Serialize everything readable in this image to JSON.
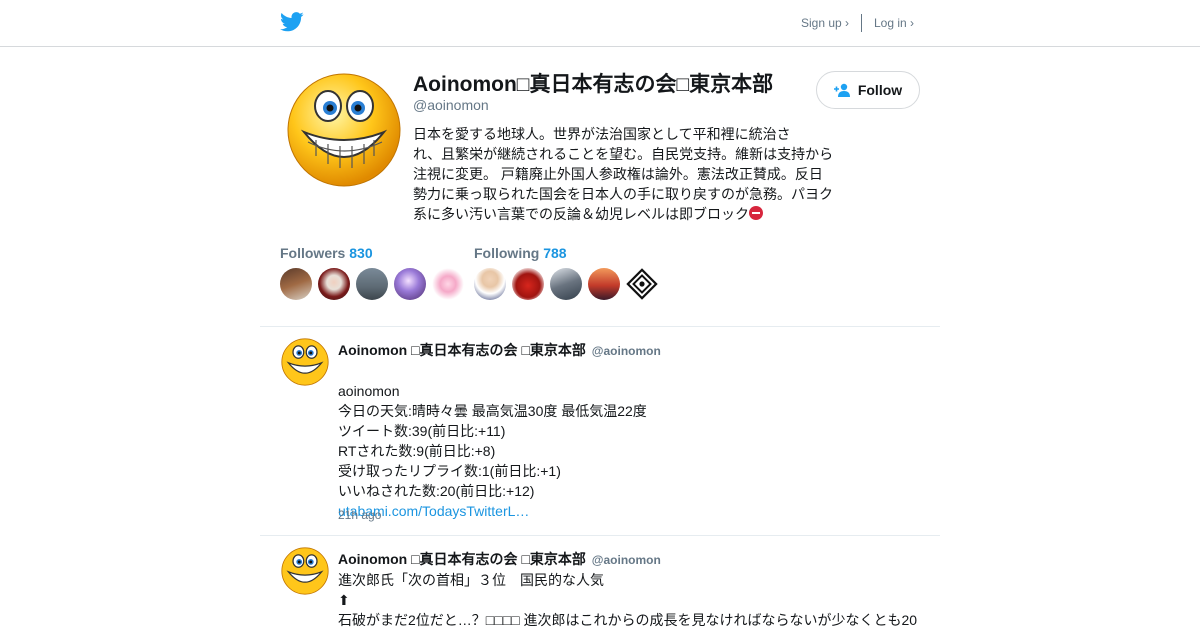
{
  "nav": {
    "signup_label": "Sign up ›",
    "login_label": "Log in ›"
  },
  "profile": {
    "display_name": "Aoinomon□真日本有志の会□東京本部",
    "handle": "@aoinomon",
    "follow_label": "Follow",
    "bio": "日本を愛する地球人。世界が法治国家として平和裡に統治さ\nれ、且繁栄が継続されることを望む。自民党支持。維新は支持から\n注視に変更。 戸籍廃止外国人参政権は論外。憲法改正賛成。反日\n勢力に乗っ取られた国会を日本人の手に取り戻すのが急務。パヨク\n系に多い汚い言葉での反論＆幼児レベルは即ブロック"
  },
  "stats": {
    "followers_label": "Followers",
    "followers_count": "830",
    "following_label": "Following",
    "following_count": "788"
  },
  "tweets": [
    {
      "name": "Aoinomon □真日本有志の会 □東京本部",
      "handle": "@aoinomon",
      "text": "aoinomon\n今日の天気:晴時々曇 最高気温30度 最低気温22度\nツイート数:39(前日比:+11)\nRTされた数:9(前日比:+8)\n受け取ったリプライ数:1(前日比:+1)\nいいねされた数:20(前日比:+12)",
      "link": "utabami.com/TodaysTwitterL…",
      "time": "21h ago"
    },
    {
      "name": "Aoinomon □真日本有志の会 □東京本部",
      "handle": "@aoinomon",
      "text": "進次郎氏「次の首相」３位　国民的な人気\n⬆\n石破がまだ2位だと…？□□□□ 進次郎はこれからの成長を見なければならないが少なくとも20"
    }
  ],
  "colors": {
    "accent": "#1b95e0",
    "muted": "#657786",
    "border": "#e6ecf0"
  },
  "icons": {
    "logo": "twitter-bird-icon",
    "follow": "add-person-icon",
    "bio_emoji": "no-entry-icon"
  }
}
